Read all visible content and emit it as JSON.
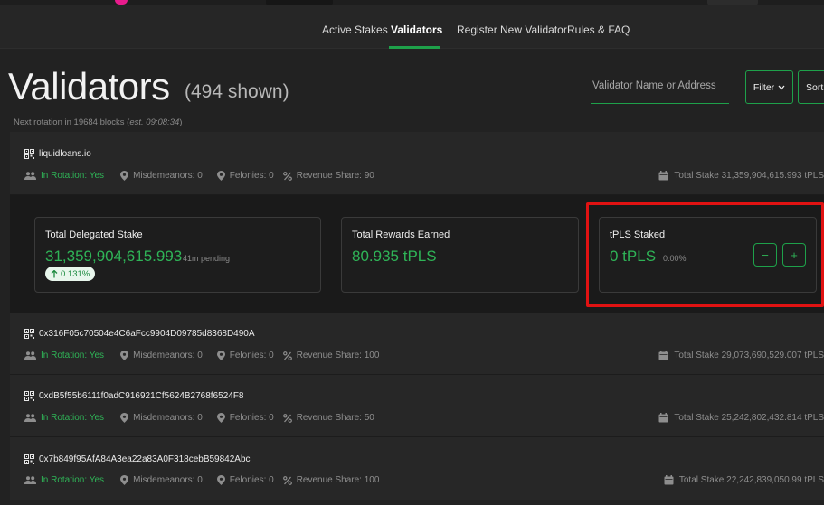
{
  "nav": {
    "items": [
      {
        "label": "Active Stakes",
        "active": false
      },
      {
        "label": "Validators",
        "active": true
      },
      {
        "label": "Register New Validator",
        "active": false
      },
      {
        "label": "Rules & FAQ",
        "active": false
      }
    ]
  },
  "header": {
    "title": "Validators",
    "count": "(494 shown)",
    "rotation_prefix": "Next rotation in 19684 blocks (",
    "rotation_est": "est. 09:08:34",
    "rotation_suffix": ")"
  },
  "toolbar": {
    "search_placeholder": "Validator Name or Address",
    "filter_label": "Filter",
    "sort_label": "Sort"
  },
  "labels": {
    "misdemeanors": "Misdemeanors: 0",
    "felonies": "Felonies: 0"
  },
  "validators": [
    {
      "name": "liquidloans.io",
      "rotation": "In Rotation: Yes",
      "revenue": "Revenue Share: 90",
      "total_stake": "Total Stake 31,359,904,615.993 tPLS"
    },
    {
      "name": "0x316F05c70504e4C6aFcc9904D09785d8368D490A",
      "rotation": "In Rotation: Yes",
      "revenue": "Revenue Share: 100",
      "total_stake": "Total Stake 29,073,690,529.007 tPLS"
    },
    {
      "name": "0xdB5f55b6111f0adC916921Cf5624B2768f6524F8",
      "rotation": "In Rotation: Yes",
      "revenue": "Revenue Share: 50",
      "total_stake": "Total Stake 25,242,802,432.814 tPLS"
    },
    {
      "name": "0x7b849f95AfA84A3ea22a83A0F318cebB59842Abc",
      "rotation": "In Rotation: Yes",
      "revenue": "Revenue Share: 100",
      "total_stake": "Total Stake 22,242,839,050.99 tPLS"
    }
  ],
  "details": {
    "delegated": {
      "title": "Total Delegated Stake",
      "value": "31,359,904,615.993",
      "pending": "41m pending",
      "change": "0.131%"
    },
    "rewards": {
      "title": "Total Rewards Earned",
      "value": "80.935 tPLS"
    },
    "staked": {
      "title": "tPLS Staked",
      "value": "0 tPLS",
      "percent": "0.00%",
      "minus": "−",
      "plus": "+"
    }
  },
  "colors": {
    "accent": "#1ea14a",
    "highlight": "#e01212",
    "background": "#222222"
  }
}
